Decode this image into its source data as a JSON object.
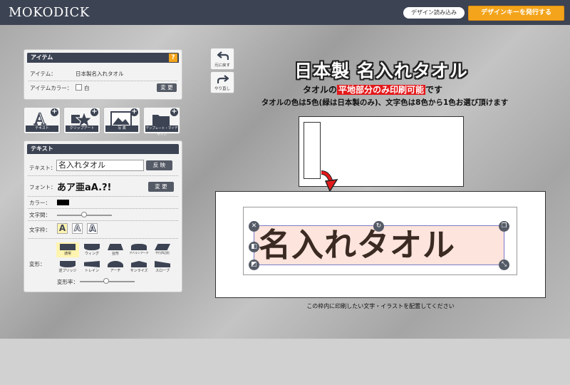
{
  "header": {
    "logo": "MOKODICK",
    "load_design": "デザイン読み込み",
    "issue_key": "デザインキーを発行する"
  },
  "item_panel": {
    "title": "アイテム",
    "help": "?",
    "item_label": "アイテム：",
    "item_value": "日本製名入れタオル",
    "color_label": "アイテムカラー：",
    "color_value": "白",
    "change_button": "変 更"
  },
  "tools": [
    {
      "label": "テキスト",
      "icon": "text-a-icon"
    },
    {
      "label": "クリップアート",
      "icon": "star-shapes-icon"
    },
    {
      "label": "写 真",
      "icon": "photo-icon"
    },
    {
      "label": "テンプレート・マイデザイン",
      "icon": "folder-icon"
    }
  ],
  "text_panel": {
    "title": "テキスト",
    "text_label": "テキスト：",
    "text_value": "名入れタオル",
    "apply_button": "反 映",
    "font_label": "フォント：",
    "font_sample": "あア亜aA.?!",
    "font_change_button": "変 更",
    "color_label": "カラー：",
    "color_value": "#000000",
    "spacing_label": "文字間：",
    "frame_label": "文字枠：",
    "frame_options": [
      "A",
      "A",
      "A"
    ],
    "transform_label": "変形：",
    "shapes": [
      "通常",
      "ウィング",
      "台形",
      "アバランアーチ",
      "平行四辺形",
      "逆ブリッジ",
      "トレイン",
      "アーチ",
      "サンライズ",
      "スロープ"
    ],
    "transform_rate_label": "変形率："
  },
  "history": {
    "undo_label": "元に戻す",
    "redo_label": "やり直し"
  },
  "canvas": {
    "title": "日本製 名入れタオル",
    "subtitle_before": "タオルの",
    "subtitle_highlight": "平地部分のみ印刷可能",
    "subtitle_after": "です",
    "description": "タオルの色は5色(緑は日本製のみ)、文字色は8色から1色お選び頂けます",
    "design_text": "名入れタオル",
    "caption": "この枠内に印刷したい文字・イラストを配置してください"
  },
  "colors": {
    "header_bg": "#3c4353",
    "accent_orange": "#f4a41b",
    "highlight_red": "#e3191b",
    "text_bg": "#fde4dc"
  }
}
